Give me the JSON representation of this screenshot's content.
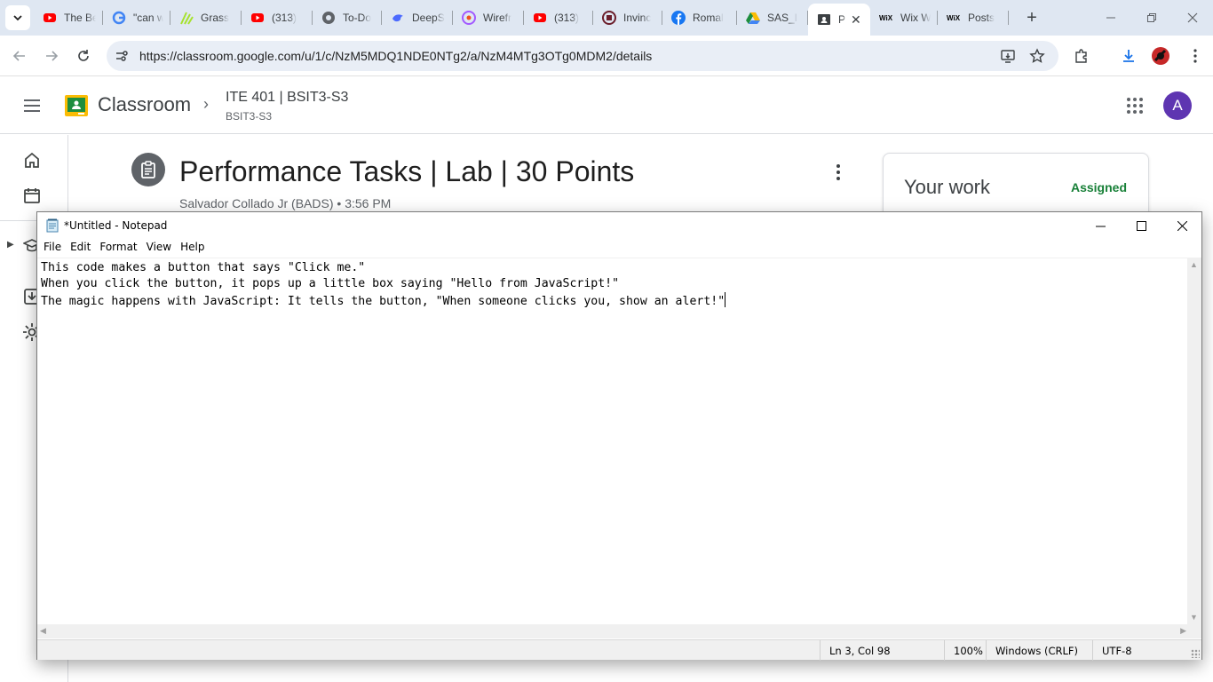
{
  "browser": {
    "tabs": [
      {
        "title": "The Be",
        "icon": "youtube-icon",
        "active": false
      },
      {
        "title": "\"can w",
        "icon": "google-icon",
        "active": false
      },
      {
        "title": "Grass",
        "icon": "grass-icon",
        "active": false
      },
      {
        "title": "(313) ",
        "icon": "youtube-icon",
        "active": false
      },
      {
        "title": "To-Do",
        "icon": "globe-icon",
        "active": false
      },
      {
        "title": "DeepS",
        "icon": "deepseek-icon",
        "active": false
      },
      {
        "title": "Wirefr",
        "icon": "figma-icon",
        "active": false
      },
      {
        "title": "(313) ",
        "icon": "youtube-icon",
        "active": false
      },
      {
        "title": "Invinc",
        "icon": "invincible-icon",
        "active": false
      },
      {
        "title": "Romal",
        "icon": "facebook-icon",
        "active": false
      },
      {
        "title": "SAS_I",
        "icon": "google-drive-icon",
        "active": false
      },
      {
        "title": "P",
        "icon": "classroom-icon",
        "active": true
      },
      {
        "title": "Wix W",
        "icon": "wix-icon",
        "active": false
      },
      {
        "title": "Posts",
        "icon": "wix-icon",
        "active": false
      }
    ],
    "url": "https://classroom.google.com/u/1/c/NzM5MDQ1NDE0NTg2/a/NzM4MTg3OTg0MDM2/details"
  },
  "classroom": {
    "app_name": "Classroom",
    "course_name": "ITE 401 | BSIT3-S3",
    "course_section": "BSIT3-S3",
    "avatar_letter": "A",
    "assignment_title": "Performance Tasks | Lab | 30 Points",
    "assignment_meta": "Salvador Collado Jr (BADS) • 3:56 PM",
    "your_work_title": "Your work",
    "your_work_status": "Assigned"
  },
  "notepad": {
    "window_title": "*Untitled - Notepad",
    "menu": [
      "File",
      "Edit",
      "Format",
      "View",
      "Help"
    ],
    "lines": [
      "This code makes a button that says \"Click me.\"",
      "When you click the button, it pops up a little box saying \"Hello from JavaScript!\"",
      "The magic happens with JavaScript: It tells the button, \"When someone clicks you, show an alert!\""
    ],
    "status": {
      "position": "Ln 3, Col 98",
      "zoom": "100%",
      "line_endings": "Windows (CRLF)",
      "encoding": "UTF-8"
    }
  },
  "colors": {
    "tabstrip_bg": "#dfe7f2",
    "omnibox_bg": "#e9eef6",
    "avatar_bg": "#5e35b1",
    "status_assigned": "#188038",
    "classroom_green": "#1e8e3e",
    "classroom_yellow": "#fbbc04"
  }
}
